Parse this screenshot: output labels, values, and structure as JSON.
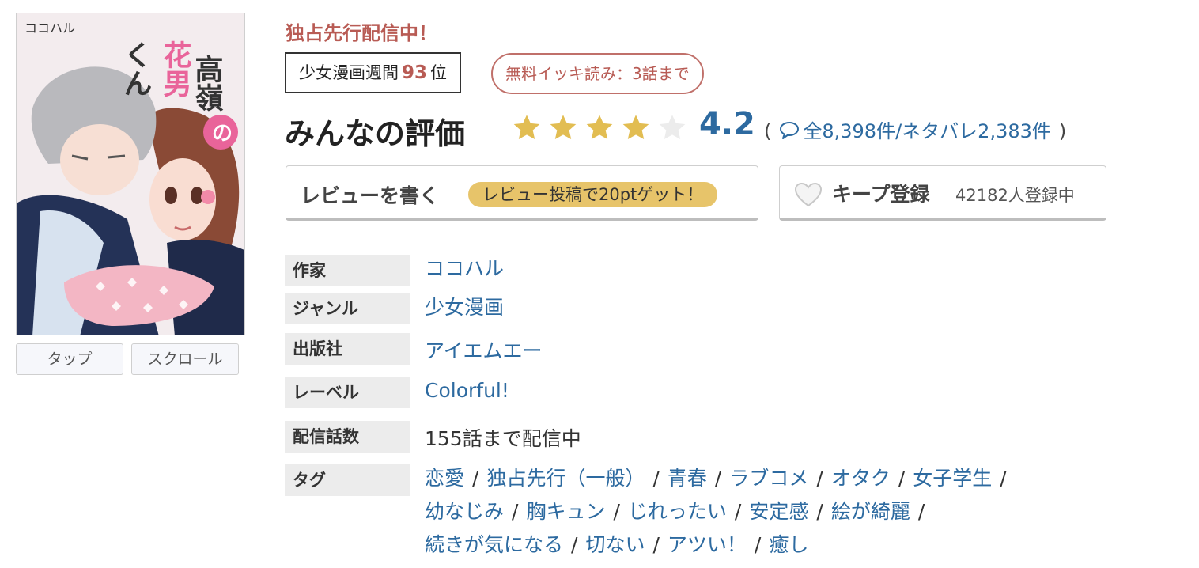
{
  "cover": {
    "author_text": "ココハル",
    "title_col1": "高嶺",
    "title_col2": "花男",
    "title_col3": "くん",
    "title_no": "の",
    "tap_label": "タップ",
    "scroll_label": "スクロール"
  },
  "exclusive_label": "独占先行配信中！",
  "ranking": {
    "prefix": "少女漫画週間",
    "rank": "93",
    "suffix": "位"
  },
  "free_badge": "無料イッキ読み：3話まで",
  "rating": {
    "title": "みんなの評価",
    "score": "4.2",
    "stars_filled": 4,
    "stars_total": 5,
    "open_paren": "(",
    "total_reviews": "全8,398件",
    "slash": "/",
    "spoiler_reviews": "ネタバレ2,383件",
    "close_paren": ")"
  },
  "write_review": {
    "label": "レビューを書く",
    "bonus": "レビュー投稿で20ptゲット！"
  },
  "keep": {
    "label": "キープ登録",
    "count": "42182人登録中"
  },
  "meta": {
    "author_label": "作家",
    "author": "ココハル",
    "genre_label": "ジャンル",
    "genre": "少女漫画",
    "publisher_label": "出版社",
    "publisher": "アイエムエー",
    "label_label": "レーベル",
    "label": "Colorful!",
    "episodes_label": "配信話数",
    "episodes": "155話まで配信中",
    "tags_label": "タグ"
  },
  "tags": [
    "恋愛",
    "独占先行（一般）",
    "青春",
    "ラブコメ",
    "オタク",
    "女子学生",
    "幼なじみ",
    "胸キュン",
    "じれったい",
    "安定感",
    "絵が綺麗",
    "続きが気になる",
    "切ない",
    "アツい！",
    "癒し"
  ],
  "tag_separator": "/",
  "colors": {
    "accent_red": "#b85b54",
    "link_blue": "#2d6aa0",
    "star_gold": "#e2bd52",
    "pill_yellow": "#e7c46a"
  }
}
